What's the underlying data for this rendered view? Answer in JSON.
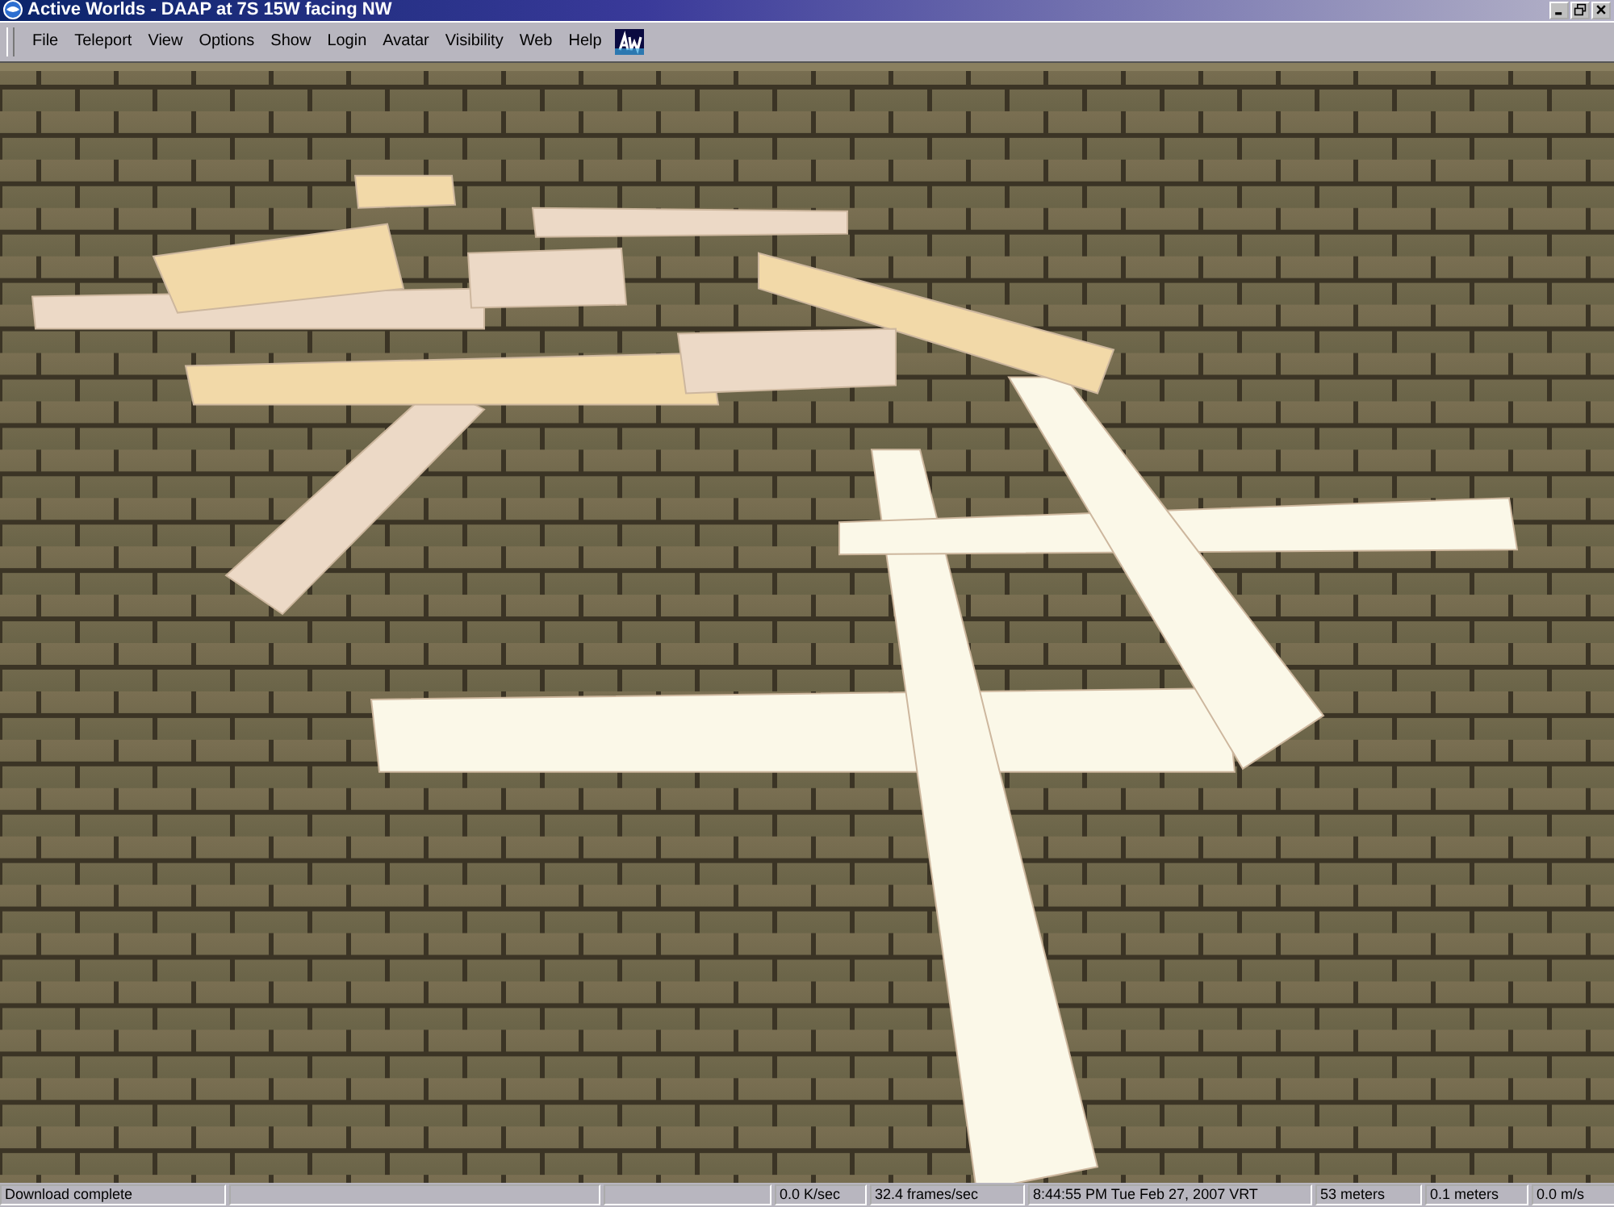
{
  "window": {
    "title": "Active Worlds - DAAP at 7S 15W facing NW"
  },
  "menu": [
    "File",
    "Teleport",
    "View",
    "Options",
    "Show",
    "Login",
    "Avatar",
    "Visibility",
    "Web",
    "Help"
  ],
  "status_bar": [
    "Download complete",
    "0.0 K/sec",
    "32.4 frames/sec",
    "8:44:55 PM Tue Feb 27, 2007 VRT",
    "53 meters",
    "0.1 meters",
    "0.0 m/s"
  ]
}
